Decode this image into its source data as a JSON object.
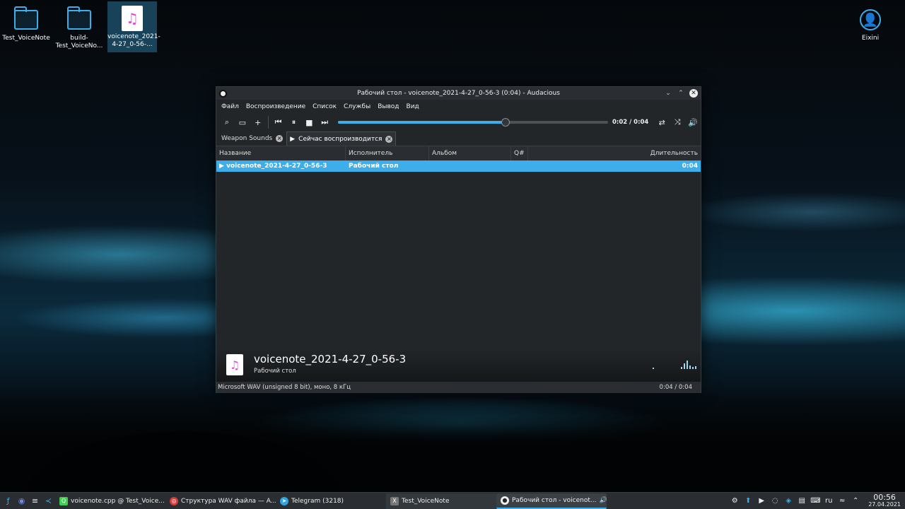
{
  "desktop": {
    "icons": [
      {
        "label": "Test_VoiceNote"
      },
      {
        "label": "build-Test_VoiceNo..."
      },
      {
        "label": "voicenote_2021-4-27_0-56-..."
      }
    ],
    "user": {
      "label": "Eixini"
    }
  },
  "window": {
    "title": "Рабочий стол - voicenote_2021-4-27_0-56-3 (0:04) - Audacious",
    "menu": [
      "Файл",
      "Воспроизведение",
      "Список",
      "Службы",
      "Вывод",
      "Вид"
    ],
    "toolbar": {
      "time": "0:02 / 0:04",
      "progress_fraction": 0.62
    },
    "tabs": [
      {
        "label": "Weapon Sounds",
        "active": false
      },
      {
        "label": "Сейчас воспроизводится",
        "active": true
      }
    ],
    "columns": [
      "Название",
      "Исполнитель",
      "Альбом",
      "Q#",
      "Длительность"
    ],
    "rows": [
      {
        "title": "voicenote_2021-4-27_0-56-3",
        "artist": "Рабочий стол",
        "album": "",
        "queue": "",
        "length": "0:04"
      }
    ],
    "info": {
      "title": "voicenote_2021-4-27_0-56-3",
      "artist": "Рабочий стол"
    },
    "status": {
      "format": "Microsoft WAV (unsigned 8 bit), моно, 8 кГц",
      "time": "0:04 / 0:04"
    }
  },
  "taskbar": {
    "tasks": [
      {
        "label": "voicenote.cpp @ Test_Voice...",
        "color": "#41cd52"
      },
      {
        "label": "Структура WAV файла — A...",
        "color": "#d63a3a"
      },
      {
        "label": "Telegram (3218)",
        "color": "#2ca5e0"
      },
      {
        "label": "Test_VoiceNote",
        "color": "#777777"
      },
      {
        "label": "Рабочий стол - voicenot...",
        "color": "#eeeeee"
      }
    ],
    "telegram_badge": "3218",
    "layout": "ru",
    "time": "00:56",
    "date": "27.04.2021"
  },
  "colors": {
    "accent": "#3daee9",
    "window_bg": "#232629"
  }
}
